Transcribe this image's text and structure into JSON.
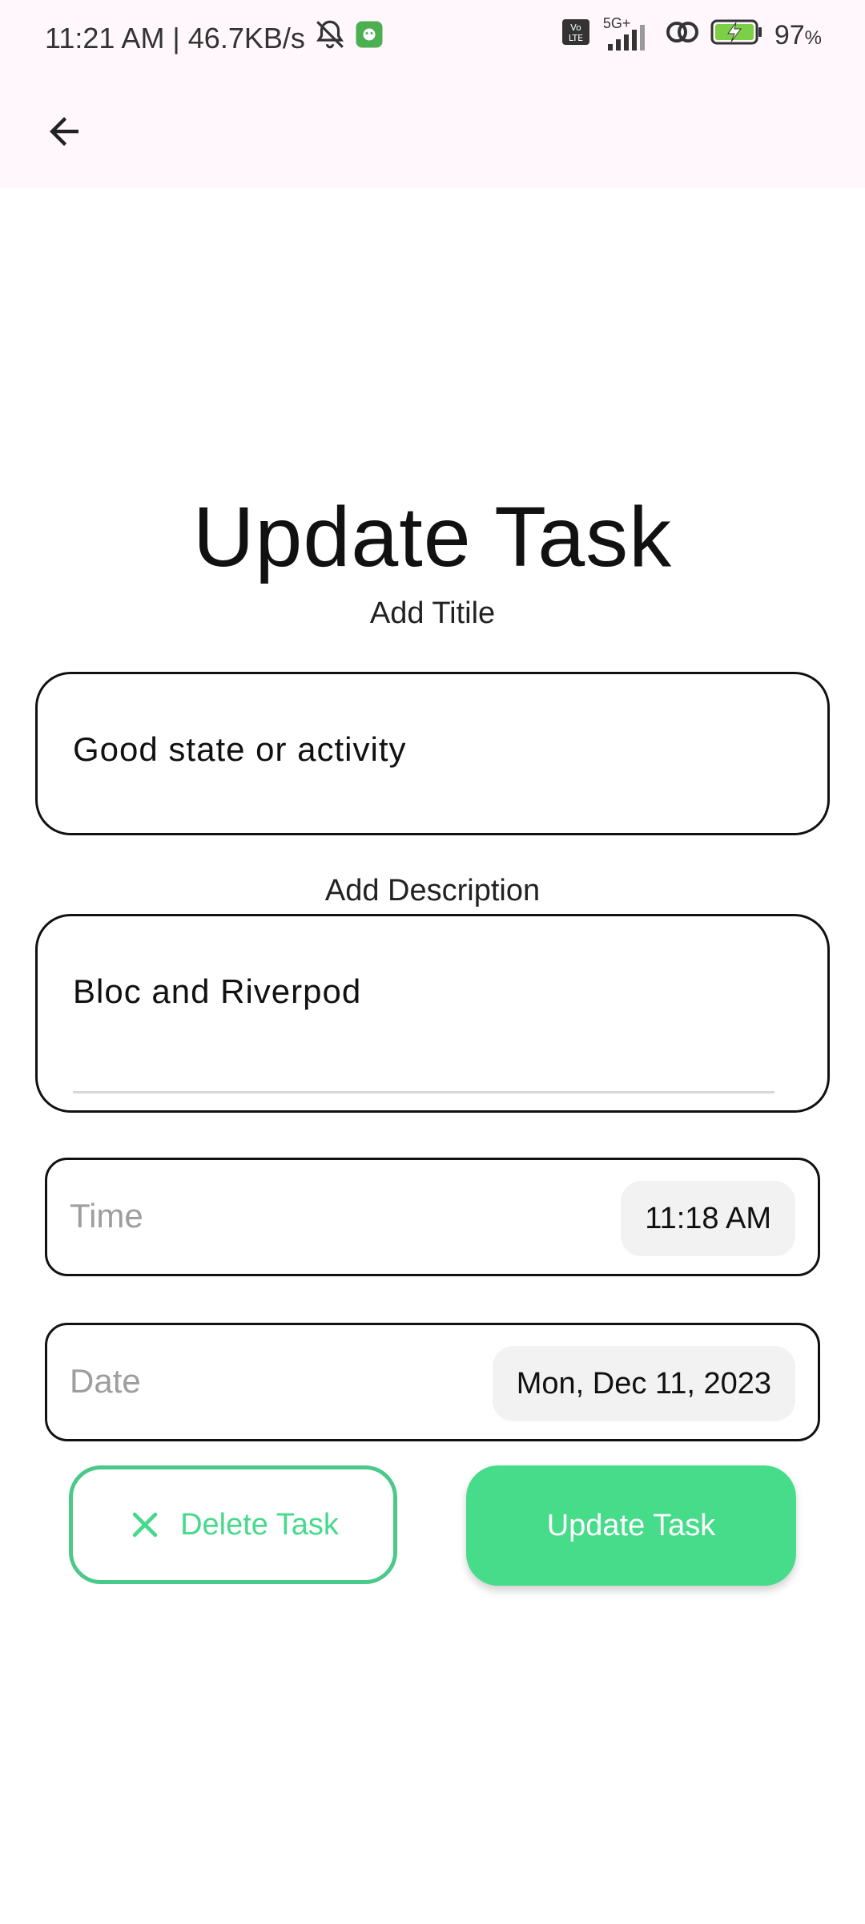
{
  "status_bar": {
    "time": "11:21 AM | 46.7KB/s",
    "network": "5G+",
    "battery": "97",
    "battery_unit": "%",
    "volte": "Vo LTE"
  },
  "app_bar": {
    "back_icon": "arrow-left-icon"
  },
  "page": {
    "title": "Update Task"
  },
  "title_section": {
    "label": "Add Titile",
    "value": "Good state or activity"
  },
  "description_section": {
    "label": "Add Description",
    "value": "Bloc and Riverpod"
  },
  "time_picker": {
    "placeholder": "Time",
    "value": "11:18 AM"
  },
  "date_picker": {
    "placeholder": "Date",
    "value": "Mon, Dec 11, 2023"
  },
  "actions": {
    "delete_label": "Delete Task",
    "update_label": "Update Task"
  },
  "colors": {
    "accent_green": "#46DC8A",
    "appbar_bg": "#FFF7FB"
  }
}
